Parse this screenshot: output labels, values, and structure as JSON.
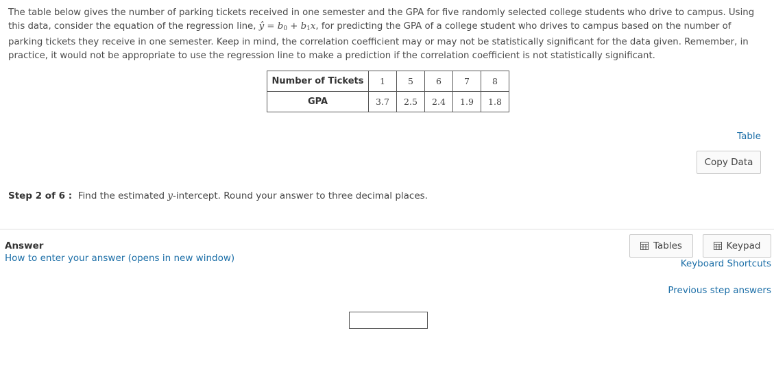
{
  "intro": {
    "part1": "The table below gives the number of parking tickets received in one semester and the GPA for five randomly selected college students who drive to campus. Using this data, consider the equation of the regression line, ",
    "equation": "ŷ = b",
    "equation_sub0": "0",
    "equation_mid": " + b",
    "equation_sub1": "1",
    "equation_end": "x",
    "part2": ", for predicting the GPA of a college student who drives to campus based on the number of parking tickets they receive in one semester. Keep in mind, the correlation coefficient may or may not be statistically significant for the data given. Remember, in practice, it would not be appropriate to use the regression line to make a prediction if the correlation coefficient is not statistically significant."
  },
  "table": {
    "rows": [
      {
        "header": "Number of Tickets",
        "values": [
          "1",
          "5",
          "6",
          "7",
          "8"
        ]
      },
      {
        "header": "GPA",
        "values": [
          "3.7",
          "2.5",
          "2.4",
          "1.9",
          "1.8"
        ]
      }
    ]
  },
  "links": {
    "table": "Table",
    "how_to": "How to enter your answer (opens in new window)",
    "keyboard_shortcuts": "Keyboard Shortcuts",
    "previous_step_answers": "Previous step answers"
  },
  "buttons": {
    "copy_data": "Copy Data",
    "tables": "Tables",
    "keypad": "Keypad"
  },
  "step": {
    "label": "Step 2 of 6 :",
    "text_before": "Find the estimated ",
    "var": "y",
    "text_after": "-intercept. Round your answer to three decimal places."
  },
  "answer": {
    "label": "Answer",
    "value": ""
  }
}
